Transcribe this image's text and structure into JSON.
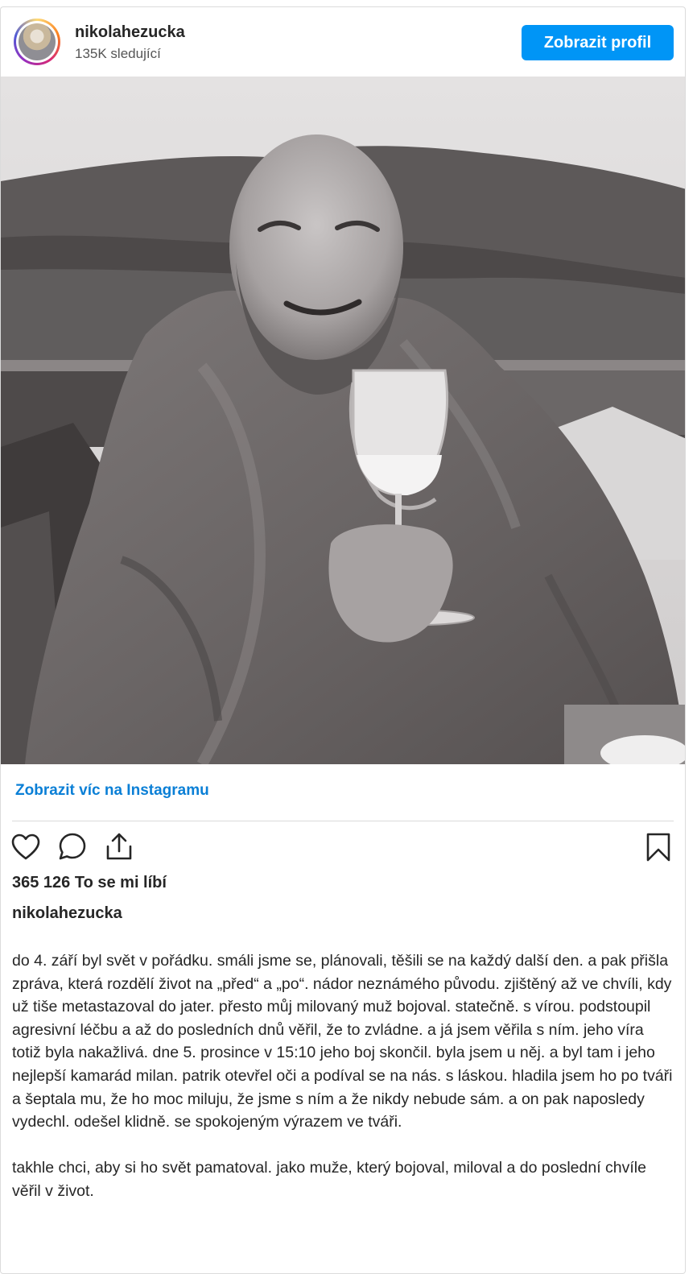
{
  "post": {
    "username": "nikolahezucka",
    "followers": "135K sledující",
    "view_profile_label": "Zobrazit profil",
    "more_link_label": "Zobrazit víc na Instagramu",
    "likes": "365 126 To se mi líbí",
    "caption_username": "nikolahezucka",
    "caption_paragraphs": [
      "do 4. září byl svět v pořádku. smáli jsme se, plánovali, těšili se na každý další den. a pak přišla zpráva, která rozdělí život na „před“ a „po“. nádor neznámého původu. zjištěný až ve chvíli, kdy už tiše metastazoval do jater. přesto můj milovaný muž bojoval. statečně. s vírou. podstoupil agresivní léčbu a až do posledních dnů věřil, že to zvládne. a já jsem věřila s ním. jeho víra totiž byla nakažlivá. dne 5. prosince v 15:10 jeho boj skončil. byla jsem u něj. a byl tam i jeho nejlepší kamarád milan. patrik otevřel oči a podíval se na nás. s láskou. hladila jsem ho po tváři a šeptala mu, že ho moc miluju, že jsme s ním a že nikdy nebude sám. a on pak naposledy vydechl. odešel klidně. se spokojeným výrazem ve tváři.",
      "takhle chci, aby si ho svět pamatoval. jako muže, který bojoval, miloval a do poslední chvíle věřil v život."
    ]
  },
  "icons": {
    "like": "heart-icon",
    "comment": "comment-icon",
    "share": "share-icon",
    "save": "bookmark-icon"
  },
  "colors": {
    "accent": "#0095f6",
    "link": "#0a7fd6",
    "text": "#262626",
    "border": "#dbdbdb"
  }
}
